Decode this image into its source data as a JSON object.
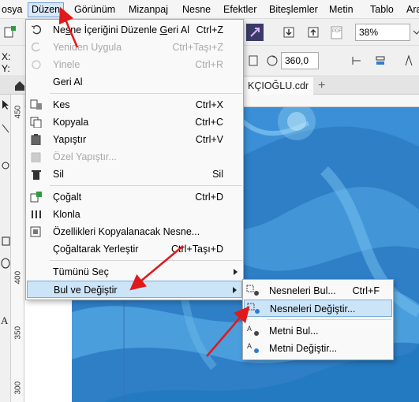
{
  "menubar": {
    "items": [
      "osya",
      "Düzen",
      "Görünüm",
      "Mizanpaj",
      "Nesne",
      "Efektler",
      "Biteşlemler",
      "Metin",
      "Tablo",
      "Ara"
    ]
  },
  "toolbar": {
    "zoom": "38%",
    "angle": "360,0",
    "x_label": "X:",
    "y_label": "Y:"
  },
  "tabs": {
    "document": "KÇIOĞLU.cdr",
    "add_tab": "+"
  },
  "ruler": {
    "vertical_labels": [
      "450",
      "400",
      "350",
      "300"
    ]
  },
  "edit_menu": {
    "items": [
      {
        "label_pre": "Ne",
        "label_u": "s",
        "label_post": "ne İçeriğini Düzenle ",
        "label_u2": "G",
        "label_post2": "eri Al",
        "shortcut": "Ctrl+Z",
        "disabled": false
      },
      {
        "label": "Yeniden Uygula",
        "shortcut": "Ctrl+Taşı+Z",
        "disabled": true
      },
      {
        "label": "Yinele",
        "shortcut": "Ctrl+R",
        "disabled": true
      },
      {
        "label": "Geri Al",
        "shortcut": "",
        "disabled": false
      },
      {
        "label": "Kes",
        "shortcut": "Ctrl+X",
        "disabled": false
      },
      {
        "label": "Kopyala",
        "shortcut": "Ctrl+C",
        "disabled": false
      },
      {
        "label": "Yapıştır",
        "shortcut": "Ctrl+V",
        "disabled": false
      },
      {
        "label": "Özel Yapıştır...",
        "shortcut": "",
        "disabled": true
      },
      {
        "label": "Sil",
        "shortcut": "Sil",
        "disabled": false
      },
      {
        "label": "Çoğalt",
        "shortcut": "Ctrl+D",
        "disabled": false
      },
      {
        "label": "Klonla",
        "shortcut": "",
        "disabled": false
      },
      {
        "label": "Özellikleri Kopyalanacak Nesne...",
        "shortcut": "",
        "disabled": false
      },
      {
        "label": "Çoğaltarak Yerleştir",
        "shortcut": "Ctrl+Taşı+D",
        "disabled": false
      },
      {
        "label": "Tümünü Seç",
        "shortcut": "",
        "disabled": false
      },
      {
        "label": "Bul ve Değiştir",
        "shortcut": "",
        "disabled": false
      }
    ]
  },
  "find_submenu": {
    "items": [
      {
        "label": "Nesneleri Bul...",
        "shortcut": "Ctrl+F"
      },
      {
        "label": "Nesneleri Değiştir...",
        "shortcut": ""
      },
      {
        "label": "Metni Bul...",
        "shortcut": ""
      },
      {
        "label": "Metni Değiştir...",
        "shortcut": ""
      }
    ]
  },
  "colors": {
    "annotation_arrow": "#e0191b",
    "menu_highlight": "#cce4f7",
    "canvas_blue": "#2f7fc7"
  }
}
